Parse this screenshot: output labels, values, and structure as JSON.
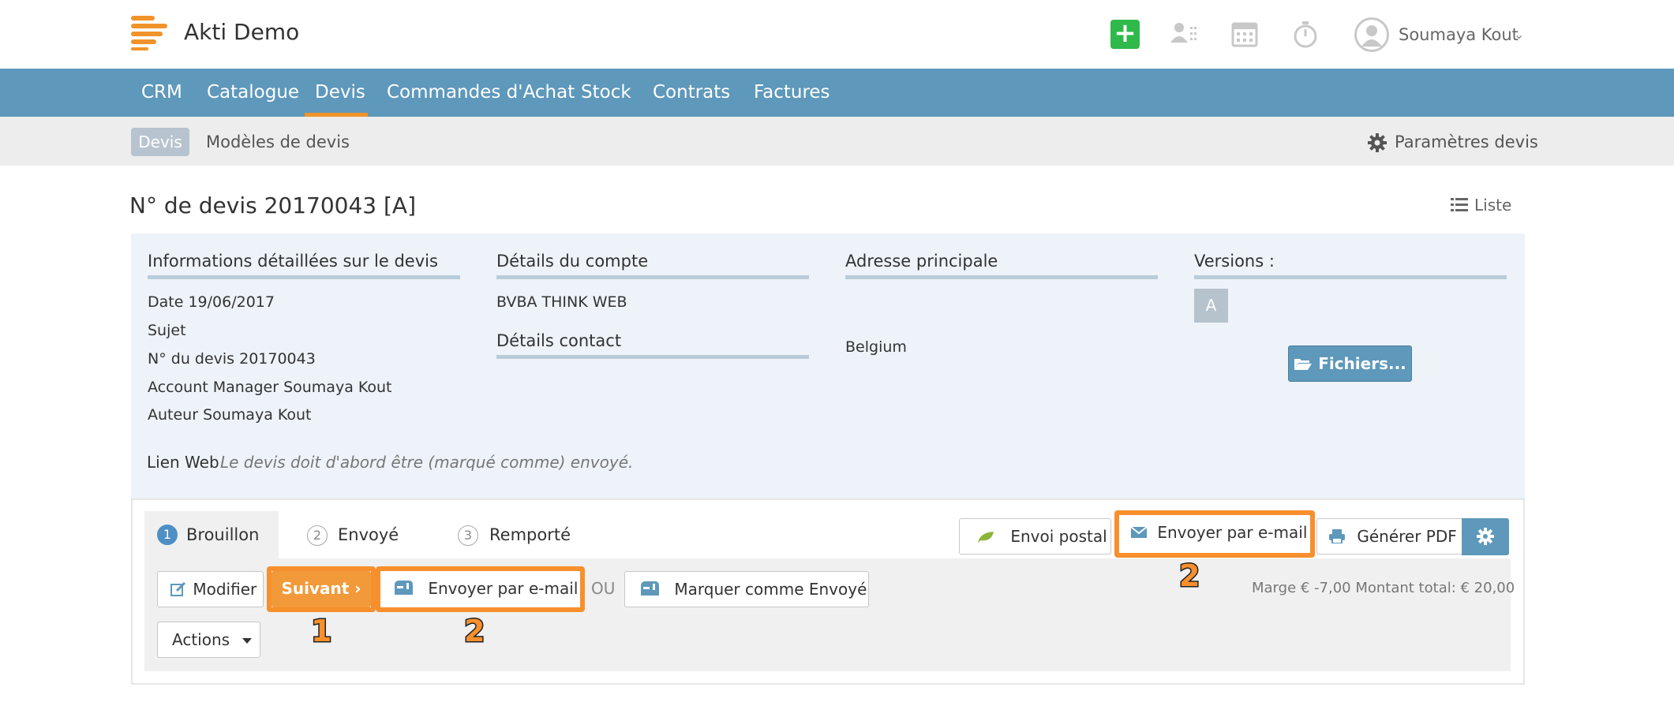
{
  "app": {
    "title": "Akti Demo"
  },
  "header": {
    "user_name": "Soumaya Kout"
  },
  "nav": {
    "items": [
      {
        "label": "CRM"
      },
      {
        "label": "Catalogue"
      },
      {
        "label": "Devis"
      },
      {
        "label": "Commandes d'Achat"
      },
      {
        "label": "Stock"
      },
      {
        "label": "Contrats"
      },
      {
        "label": "Factures"
      }
    ],
    "active": "Devis"
  },
  "subnav": {
    "active_label": "Devis",
    "item": "Modèles de devis",
    "settings": "Paramètres devis"
  },
  "page": {
    "title": "N° de devis 20170043 [A]",
    "list_link": "Liste"
  },
  "info": {
    "col1_head": "Informations détaillées sur le devis",
    "col1_lines": [
      "Date 19/06/2017",
      "Sujet",
      "N° du devis 20170043",
      "Account Manager Soumaya Kout",
      "Auteur Soumaya Kout"
    ],
    "col2_head": "Détails du compte",
    "col2_company": "BVBA THINK WEB",
    "col2_sub_head": "Détails contact",
    "col3_head": "Adresse principale",
    "col3_country": "Belgium",
    "col4_head": "Versions :",
    "version": "A",
    "files_button": "Fichiers...",
    "weblink_label": "Lien Web",
    "weblink_note": "Le devis doit d'abord être (marqué comme) envoyé."
  },
  "workflow": {
    "steps": [
      {
        "num": "1",
        "label": "Brouillon"
      },
      {
        "num": "2",
        "label": "Envoyé"
      },
      {
        "num": "3",
        "label": "Remporté"
      }
    ],
    "postal_button": "Envoi postal",
    "email_button_top": "Envoyer par e-mail",
    "pdf_button": "Générer PDF",
    "modify_button": "Modifier",
    "next_button": "Suivant ›",
    "email_button": "Envoyer par e-mail",
    "ou": "OU",
    "mark_sent_button": "Marquer comme Envoyé",
    "actions_button": "Actions",
    "totals": "Marge € -7,00 Montant total: € 20,00",
    "callouts": [
      "1",
      "2",
      "2"
    ]
  },
  "colors": {
    "nav_bg": "#5e98bb",
    "accent_orange": "#f29a3a",
    "add_green": "#2fb94a",
    "panel_bg": "#edf3f8"
  }
}
